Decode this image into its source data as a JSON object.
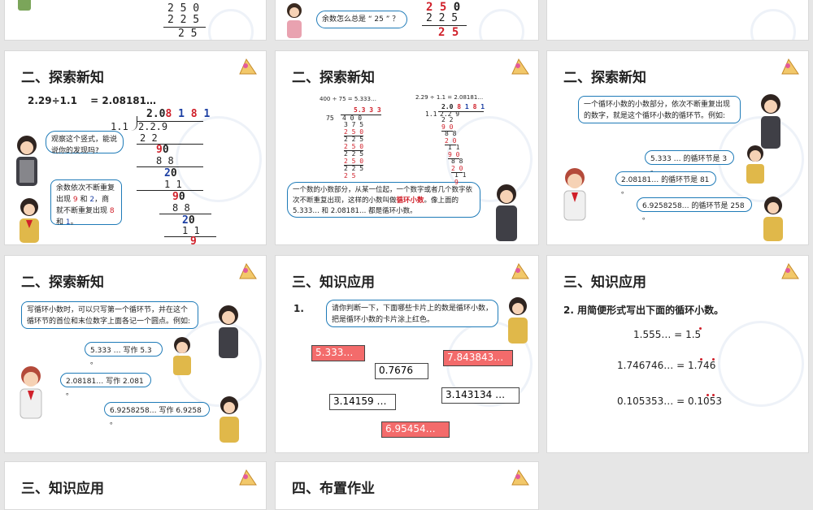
{
  "colors": {
    "accent_red": "#d0202a",
    "accent_blue": "#1c3fa3",
    "bubble_border": "#1f7bb8",
    "card_red": "#f36b6b",
    "slide_bg": "#ffffff",
    "page_bg": "#e6e6e6"
  },
  "icons": [
    "triangle-ruler-icon",
    "student-girl-icon",
    "student-boy-icon"
  ],
  "row0": {
    "s1": {
      "l1": "2 5 0",
      "l2": "2 2 5",
      "l3": "2 5"
    },
    "s2": {
      "bubble": "余数怎么总是 “ 25 ” ？",
      "l1": "2 5 0",
      "l2": "2 2 5",
      "l3": "2 5"
    }
  },
  "s4": {
    "title": "二、探索新知",
    "equation": "2.29÷1.1 　= 2.08181…",
    "q_top": "2.0",
    "q_d1": "8",
    "q_d2": "1",
    "q_d3": "8",
    "q_d4": "1",
    "divisor": "1.1",
    "dividend": "2.2.9",
    "r1": "2 2",
    "r2": "9",
    "r2b": "0",
    "r3": "8 8",
    "r4": "2",
    "r4b": "0",
    "r5": "1 1",
    "r6": "9",
    "r6b": "0",
    "r7": "8 8",
    "r8": "2",
    "r8b": "0",
    "r9": "1 1",
    "r10": "9",
    "bubble1": "观察这个竖式，能说说你的发现吗?",
    "bubble2_a": "余数依次不断重复出现 ",
    "bubble2_b": "9",
    "bubble2_c": " 和 ",
    "bubble2_d": "2",
    "bubble2_e": "，商就不断重复出现 ",
    "bubble2_f": "8",
    "bubble2_g": " 和 ",
    "bubble2_h": "1",
    "bubble2_i": "。"
  },
  "s5": {
    "title": "二、探索新知",
    "eq1": "400 ÷ 75 = 5.333…",
    "eq2": "2.29 ÷ 1.1 = 2.08181…",
    "a_q": "5.3 3 3",
    "a_div": "75",
    "a_dvd": "4 0 0",
    "a_l": [
      "3 7 5",
      "2 5 0",
      "2 2 5",
      "2 5 0",
      "2 2 5",
      "2 5 0",
      "2 2 5",
      "2 5"
    ],
    "b_q": "2.0 8 1 8 1",
    "b_div": "1.1",
    "b_dvd": "2.2 9",
    "b_l": [
      "2 2",
      "9 0",
      "8 8",
      "2 0",
      "1 1",
      "9 0",
      "8 8",
      "2 0",
      "1 1",
      "9"
    ],
    "bubble_a": "一个数的小数部分，从某一位起，一个数字或者几个数字依次不断重复出现，这样的小数叫做",
    "bubble_b": "循环小数",
    "bubble_c": "。像上面的 5.333… 和 2.08181… 都是循环小数。"
  },
  "s6": {
    "title": "二、探索新知",
    "bubble1": "一个循环小数的小数部分，依次不断重复出现的数字，就是这个循环小数的循环节。例如:",
    "b2": "5.333 … 的循环节是 3 。",
    "b3": "2.08181… 的循环节是 81 。",
    "b4": "6.9258258… 的循环节是 258 。"
  },
  "s7": {
    "title": "二、探索新知",
    "bubble1": "写循环小数时，可以只写第一个循环节，并在这个循环节的首位和末位数字上面各记一个圆点。例如:",
    "b2": "5.333 … 写作 5.3 。",
    "b3": "2.08181… 写作 2.081 。",
    "b4": "6.9258258… 写作 6.9258 。"
  },
  "s8": {
    "title": "三、知识应用",
    "num": "1.",
    "bubble": "请你判断一下，下面哪些卡片上的数是循环小数，把是循环小数的卡片涂上红色。",
    "cards": [
      "5.333…",
      "0.7676",
      "7.843843…",
      "3.14159 …",
      "3.143134 …",
      "6.95454…"
    ]
  },
  "s9": {
    "title": "三、知识应用",
    "prompt": "2. 用简便形式写出下面的循环小数。",
    "rows": [
      {
        "left": "1.555… =",
        "right": "1.5"
      },
      {
        "left": "1.746746… =",
        "right": "1.746"
      },
      {
        "left": "0.105353… =",
        "right": "0.1053"
      }
    ]
  },
  "row3": {
    "s10": {
      "title": "三、知识应用"
    },
    "s11": {
      "title": "四、布置作业"
    }
  }
}
